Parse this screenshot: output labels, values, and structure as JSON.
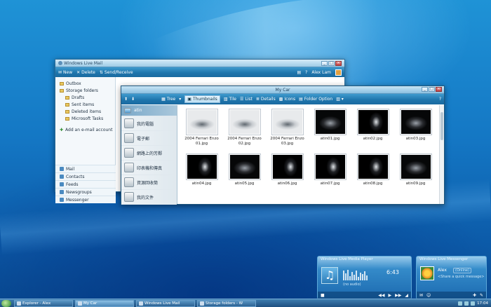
{
  "mail_window": {
    "title": "Windows Live Mail",
    "toolbar": {
      "new": "New",
      "delete": "Delete",
      "send_receive": "Send/Receive",
      "user": "Alex Lam"
    },
    "folders": [
      {
        "label": "Outbox",
        "sub": false
      },
      {
        "label": "Storage folders",
        "sub": false
      },
      {
        "label": "Drafts",
        "sub": true
      },
      {
        "label": "Sent items",
        "sub": true
      },
      {
        "label": "Deleted items",
        "sub": true
      },
      {
        "label": "Microsoft Tasks",
        "sub": true
      }
    ],
    "add_account": "Add an e-mail account",
    "nav": [
      "Mail",
      "Contacts",
      "Feeds",
      "Newsgroups",
      "Messenger"
    ]
  },
  "explorer": {
    "title": "My Car",
    "toolbar": {
      "tree": "Tree",
      "thumbnails": "Thumbnails",
      "tile": "Tile",
      "list": "List",
      "details": "Details",
      "icons": "Icons",
      "folder_option": "Folder Option"
    },
    "sidebar": [
      "atin",
      "我的電腦",
      "電子郵",
      "網路上的芳鄰",
      "印表機和傳真",
      "資源回收筒",
      "我的文件"
    ],
    "files": [
      {
        "name": "2004 Ferrari Enzo 01.jpg",
        "tone": "light"
      },
      {
        "name": "2004 Ferrari Enzo 02.jpg",
        "tone": "light"
      },
      {
        "name": "2004 Ferrari Enzo 03.jpg",
        "tone": "light"
      },
      {
        "name": "atin01.jpg",
        "tone": "dark"
      },
      {
        "name": "atin02.jpg",
        "tone": "dark2"
      },
      {
        "name": "atin03.jpg",
        "tone": "dark"
      },
      {
        "name": "atin04.jpg",
        "tone": "dark2"
      },
      {
        "name": "atin05.jpg",
        "tone": "dark"
      },
      {
        "name": "atin06.jpg",
        "tone": "dark2"
      },
      {
        "name": "atin07.jpg",
        "tone": "dark2"
      },
      {
        "name": "atin08.jpg",
        "tone": "dark2"
      },
      {
        "name": "atin09.jpg",
        "tone": "dark"
      }
    ]
  },
  "player": {
    "title": "Windows Live Media Player",
    "time": "6:43",
    "status": "(no audio)"
  },
  "messenger": {
    "title": "Windows Live Messenger",
    "name": "Alex",
    "status": "(Online)",
    "message": "<Share a quick message>"
  },
  "taskbar": {
    "tasks": [
      {
        "label": "Explorer - Alex",
        "active": false
      },
      {
        "label": "My Car",
        "active": true
      },
      {
        "label": "Windows Live Mail",
        "active": false
      },
      {
        "label": "Storage folders - W",
        "active": false
      }
    ],
    "clock": "17:04"
  }
}
